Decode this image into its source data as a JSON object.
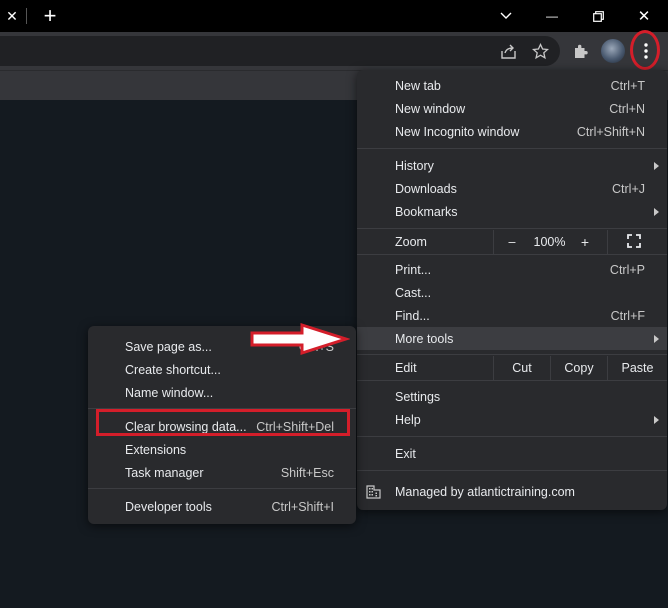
{
  "titlebar": {
    "close_tab_glyph": "✕",
    "new_tab_glyph": "+",
    "min_glyph": "—",
    "restore_glyph": "❐",
    "close_glyph": "✕"
  },
  "icons": [
    "share-icon",
    "star-icon",
    "extensions-icon",
    "avatar",
    "menu-kebab-icon",
    "chevron-down-icon",
    "building-icon"
  ],
  "main_menu": {
    "items": [
      {
        "label": "New tab",
        "shortcut": "Ctrl+T"
      },
      {
        "label": "New window",
        "shortcut": "Ctrl+N"
      },
      {
        "label": "New Incognito window",
        "shortcut": "Ctrl+Shift+N"
      },
      {
        "label": "History",
        "shortcut": ""
      },
      {
        "label": "Downloads",
        "shortcut": "Ctrl+J"
      },
      {
        "label": "Bookmarks",
        "shortcut": ""
      },
      {
        "label": "Print...",
        "shortcut": "Ctrl+P"
      },
      {
        "label": "Cast...",
        "shortcut": ""
      },
      {
        "label": "Find...",
        "shortcut": "Ctrl+F"
      },
      {
        "label": "More tools",
        "shortcut": ""
      },
      {
        "label": "Settings",
        "shortcut": ""
      },
      {
        "label": "Help",
        "shortcut": ""
      },
      {
        "label": "Exit",
        "shortcut": ""
      }
    ],
    "zoom": {
      "label": "Zoom",
      "minus": "–",
      "value": "100%",
      "plus": "+"
    },
    "edit": {
      "label": "Edit",
      "cut": "Cut",
      "copy": "Copy",
      "paste": "Paste"
    },
    "managed": "Managed by atlantictraining.com"
  },
  "more_tools_menu": {
    "items": [
      {
        "label": "Save page as...",
        "shortcut": "Ctrl+S"
      },
      {
        "label": "Create shortcut...",
        "shortcut": ""
      },
      {
        "label": "Name window...",
        "shortcut": ""
      },
      {
        "label": "Clear browsing data...",
        "shortcut": "Ctrl+Shift+Del"
      },
      {
        "label": "Extensions",
        "shortcut": ""
      },
      {
        "label": "Task manager",
        "shortcut": "Shift+Esc"
      },
      {
        "label": "Developer tools",
        "shortcut": "Ctrl+Shift+I"
      }
    ]
  },
  "colors": {
    "menu_bg": "#292a2d",
    "highlight": "#3c3d41",
    "annotation_red": "#d41e2a"
  }
}
